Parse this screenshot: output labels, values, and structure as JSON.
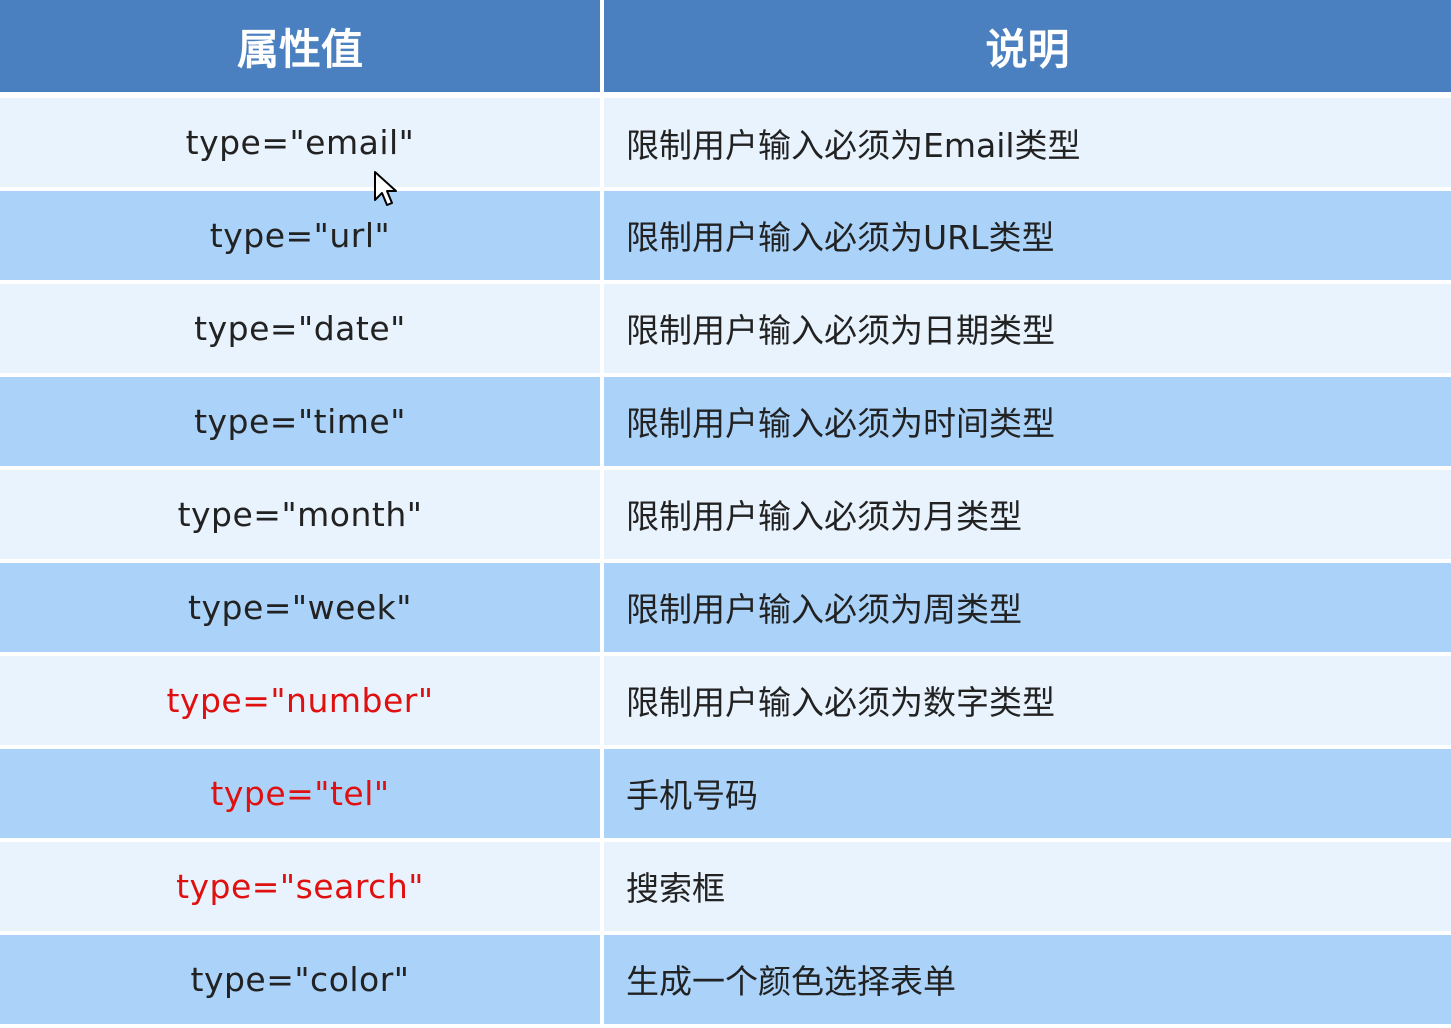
{
  "headers": {
    "attr": "属性值",
    "desc": "说明"
  },
  "rows": [
    {
      "attr": "type=\"email\"",
      "desc": "限制用户输入必须为Email类型",
      "highlight": false
    },
    {
      "attr": "type=\"url\"",
      "desc": "限制用户输入必须为URL类型",
      "highlight": false
    },
    {
      "attr": "type=\"date\"",
      "desc": "限制用户输入必须为日期类型",
      "highlight": false
    },
    {
      "attr": "type=\"time\"",
      "desc": "限制用户输入必须为时间类型",
      "highlight": false
    },
    {
      "attr": "type=\"month\"",
      "desc": "限制用户输入必须为月类型",
      "highlight": false
    },
    {
      "attr": "type=\"week\"",
      "desc": "限制用户输入必须为周类型",
      "highlight": false
    },
    {
      "attr": "type=\"number\"",
      "desc": "限制用户输入必须为数字类型",
      "highlight": true
    },
    {
      "attr": "type=\"tel\"",
      "desc": "手机号码",
      "highlight": true
    },
    {
      "attr": "type=\"search\"",
      "desc": "搜索框",
      "highlight": true
    },
    {
      "attr": "type=\"color\"",
      "desc": "生成一个颜色选择表单",
      "highlight": false
    }
  ],
  "colors": {
    "header_bg": "#4a7fc0",
    "row_light": "#e9f3fd",
    "row_dark": "#abd3fa",
    "highlight_text": "#e01010"
  },
  "icons": {
    "cursor": "mouse-pointer-icon"
  }
}
